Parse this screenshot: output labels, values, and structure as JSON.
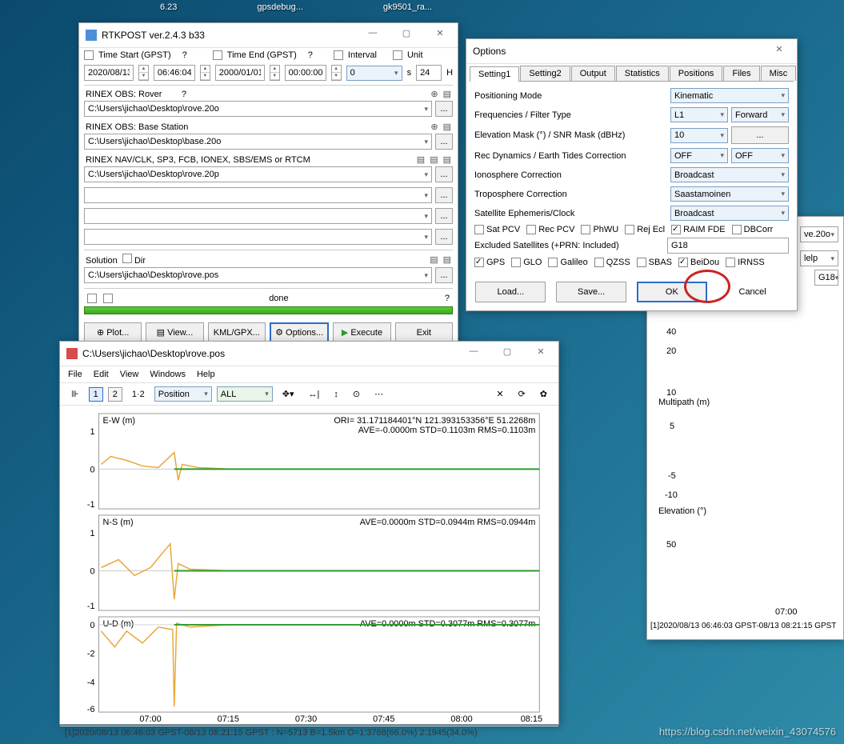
{
  "taskbar": {
    "items": [
      "6.23",
      "gpsdebug...",
      "gk9501_ra..."
    ]
  },
  "rtkpost": {
    "title": "RTKPOST ver.2.4.3 b33",
    "time_start_label": "Time Start (GPST)",
    "time_end_label": "Time End (GPST)",
    "interval_label": "Interval",
    "unit_label": "Unit",
    "q1": "?",
    "q2": "?",
    "start_date": "2020/08/13",
    "start_time": "06:46:04",
    "end_date": "2000/01/01",
    "end_time": "00:00:00",
    "interval_val": "0",
    "interval_unit": "s",
    "unit_val": "24",
    "unit_unit": "H",
    "sections": {
      "rover": {
        "label": "RINEX OBS: Rover",
        "q": "?",
        "path": "C:\\Users\\jichao\\Desktop\\rove.20o"
      },
      "base": {
        "label": "RINEX OBS: Base Station",
        "path": "C:\\Users\\jichao\\Desktop\\base.20o"
      },
      "nav": {
        "label": "RINEX NAV/CLK, SP3, FCB, IONEX, SBS/EMS  or RTCM",
        "path": "C:\\Users\\jichao\\Desktop\\rove.20p"
      },
      "solution_label": "Solution",
      "dir_label": "Dir",
      "solution_path": "C:\\Users\\jichao\\Desktop\\rove.pos"
    },
    "status": "done",
    "status_q": "?",
    "buttons": {
      "plot": "Plot...",
      "view": "View...",
      "kml": "KML/GPX...",
      "options": "Options...",
      "execute": "Execute",
      "exit": "Exit"
    }
  },
  "options": {
    "title": "Options",
    "tabs": [
      "Setting1",
      "Setting2",
      "Output",
      "Statistics",
      "Positions",
      "Files",
      "Misc"
    ],
    "rows": {
      "pos_mode": {
        "label": "Positioning Mode",
        "val": "Kinematic"
      },
      "freq": {
        "label": "Frequencies / Filter Type",
        "val1": "L1",
        "val2": "Forward"
      },
      "elev": {
        "label": "Elevation Mask (°) / SNR Mask (dBHz)",
        "val": "10",
        "btn": "..."
      },
      "rec": {
        "label": "Rec Dynamics / Earth Tides Correction",
        "val1": "OFF",
        "val2": "OFF"
      },
      "iono": {
        "label": "Ionosphere Correction",
        "val": "Broadcast"
      },
      "tropo": {
        "label": "Troposphere Correction",
        "val": "Saastamoinen"
      },
      "eph": {
        "label": "Satellite Ephemeris/Clock",
        "val": "Broadcast"
      }
    },
    "check_row1": {
      "satpcv": "Sat PCV",
      "recpcv": "Rec PCV",
      "phwu": "PhWU",
      "rejecl": "Rej Ecl",
      "raim": "RAIM FDE",
      "dbcorr": "DBCorr"
    },
    "excluded_label": "Excluded Satellites (+PRN: Included)",
    "excluded_val": "G18",
    "sys": {
      "gps": "GPS",
      "glo": "GLO",
      "gal": "Galileo",
      "qzss": "QZSS",
      "sbas": "SBAS",
      "bds": "BeiDou",
      "irnss": "IRNSS"
    },
    "footer": {
      "load": "Load...",
      "save": "Save...",
      "ok": "OK",
      "cancel": "Cancel"
    }
  },
  "plot": {
    "title": "C:\\Users\\jichao\\Desktop\\rove.pos",
    "menu": [
      "File",
      "Edit",
      "View",
      "Windows",
      "Help"
    ],
    "toolbar": {
      "n1": "1",
      "n2": "2",
      "n12": "1·2",
      "position": "Position ",
      "all": "ALL "
    },
    "header_ori": "ORI= 31.171184401°N  121.393153356°E 51.2268m",
    "subplots": [
      {
        "label": "E-W (m)",
        "stats": "AVE=-0.0000m STD=0.1103m RMS=0.1103m"
      },
      {
        "label": "N-S (m)",
        "stats": "AVE=0.0000m STD=0.0944m RMS=0.0944m"
      },
      {
        "label": "U-D (m)",
        "stats": "AVE=0.0000m STD=0.3077m RMS=0.3077m"
      }
    ],
    "xaxis_ticks": [
      "07:00",
      "07:15",
      "07:30",
      "07:45",
      "08:00",
      "08:15"
    ],
    "status": "[1]2020/08/13 06:46:03 GPST-08/13 08:21:15 GPST : N=5713 B=1.5km O=1:3768(66.0%) 2:1945(34.0%)"
  },
  "bgwin": {
    "combo1": "ve.20o",
    "combo2": "lelp",
    "combo3": "G18",
    "labels": {
      "y40": "40",
      "y20": "20",
      "y10": "10",
      "multipath": "Multipath (m)",
      "y5": "5",
      "ym5": "-5",
      "ym10": "-10",
      "elev": "Elevation (°)",
      "y50": "50",
      "xtick": "07:00"
    },
    "status": "[1]2020/08/13 06:46:03 GPST-08/13 08:21:15 GPST"
  },
  "watermark": "https://blog.csdn.net/weixin_43074576",
  "chart_data": [
    {
      "type": "line",
      "title": "E-W (m)",
      "x_ticks": [
        "07:00",
        "07:15",
        "07:30",
        "07:45",
        "08:00",
        "08:15"
      ],
      "ylim": [
        -1,
        1
      ],
      "series": [
        {
          "name": "float(orange)",
          "approx": "noisy ±0.2 around 0, mostly before 07:15"
        },
        {
          "name": "fix(green)",
          "approx": "flat ~0 after 07:05 to 08:20"
        }
      ],
      "stats": {
        "AVE": -0.0,
        "STD": 0.1103,
        "RMS": 0.1103
      }
    },
    {
      "type": "line",
      "title": "N-S (m)",
      "ylim": [
        -1,
        1
      ],
      "series": [
        {
          "name": "float(orange)",
          "approx": "noisy ±0.4 early, spike near 07:05"
        },
        {
          "name": "fix(green)",
          "approx": "flat ~0"
        }
      ],
      "stats": {
        "AVE": 0.0,
        "STD": 0.0944,
        "RMS": 0.0944
      }
    },
    {
      "type": "line",
      "title": "U-D (m)",
      "ylim": [
        -6,
        0
      ],
      "series": [
        {
          "name": "float(orange)",
          "approx": "large downward spike to ~-5.5 near 07:05, noisy -1..0 early"
        },
        {
          "name": "fix(green)",
          "approx": "flat ~0"
        }
      ],
      "stats": {
        "AVE": 0.0,
        "STD": 0.3077,
        "RMS": 0.3077
      }
    }
  ]
}
